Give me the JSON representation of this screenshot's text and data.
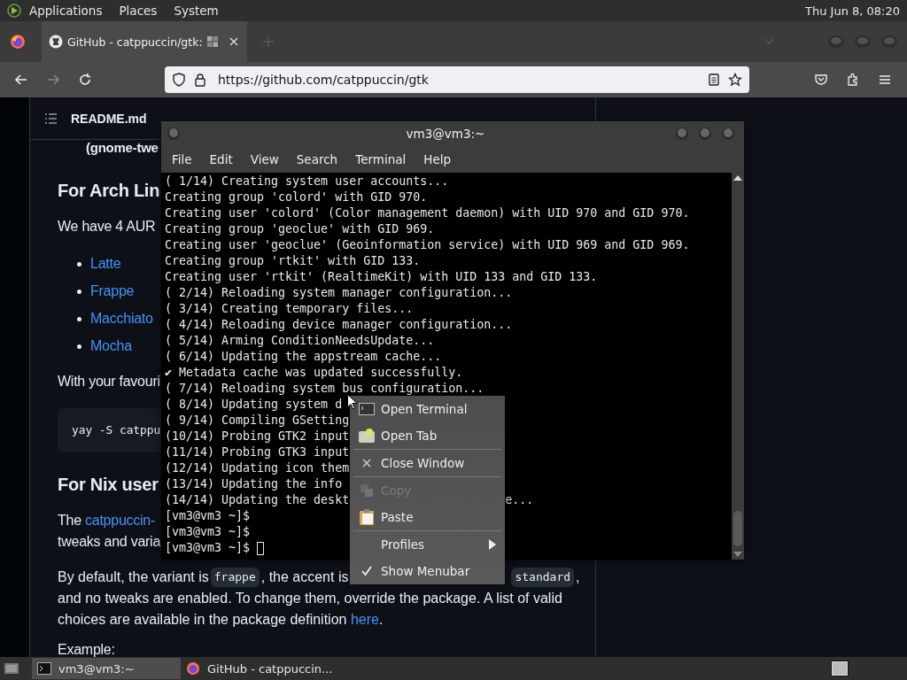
{
  "top_panel": {
    "menus": [
      "Applications",
      "Places",
      "System"
    ],
    "clock": "Thu Jun  8, 08:20"
  },
  "browser": {
    "tabs": [
      {
        "title": "GitHub - catppuccin/gtk:",
        "selected": true
      }
    ],
    "nav_buttons": [
      {
        "kind": "back",
        "disabled": false
      },
      {
        "kind": "forward",
        "disabled": true
      },
      {
        "kind": "reload",
        "disabled": false
      }
    ],
    "url": "https://github.com/catppuccin/gtk",
    "page": {
      "file_header": "README.md",
      "blocks": [
        {
          "kind": "indent",
          "text": "(gnome-twe"
        },
        {
          "kind": "heading",
          "text": "For Arch Lin"
        },
        {
          "kind": "para",
          "text": "We have 4 AUR"
        },
        {
          "kind": "link_item",
          "text": "Latte"
        },
        {
          "kind": "link_item",
          "text": "Frappe"
        },
        {
          "kind": "link_item",
          "text": "Macchiato"
        },
        {
          "kind": "link_item",
          "text": "Mocha"
        },
        {
          "kind": "para",
          "text": "With your favouri"
        },
        {
          "kind": "code",
          "text": "yay -S catppu"
        },
        {
          "kind": "heading",
          "text": "For Nix user"
        },
        {
          "kind": "para_link",
          "before": "The ",
          "link": "catppuccin-",
          "line2": "tweaks and varia"
        },
        {
          "kind": "defaults",
          "before": "By default, the variant is",
          "code1": "frappe",
          "mid": ", the accent is",
          "code2": "standard",
          "after": ",",
          "rest": "and no tweaks are enabled. To change them, override the package. A list of valid choices are available in the package definition ",
          "link": "here",
          "end": "."
        },
        {
          "kind": "para",
          "text": "Example:"
        }
      ]
    }
  },
  "terminal": {
    "title": "vm3@vm3:~",
    "menus": [
      "File",
      "Edit",
      "View",
      "Search",
      "Terminal",
      "Help"
    ],
    "lines": [
      {
        "text": "( 1/14) Creating system user accounts..."
      },
      {
        "text": "Creating group 'colord' with GID 970."
      },
      {
        "text": "Creating user 'colord' (Color management daemon) with UID 970 and GID 970."
      },
      {
        "text": "Creating group 'geoclue' with GID 969."
      },
      {
        "text": "Creating user 'geoclue' (Geoinformation service) with UID 969 and GID 969."
      },
      {
        "text": "Creating group 'rtkit' with GID 133."
      },
      {
        "text": "Creating user 'rtkit' (RealtimeKit) with UID 133 and GID 133."
      },
      {
        "text": "( 2/14) Reloading system manager configuration..."
      },
      {
        "text": "( 3/14) Creating temporary files..."
      },
      {
        "text": "( 4/14) Reloading device manager configuration..."
      },
      {
        "text": "( 5/14) Arming ConditionNeedsUpdate..."
      },
      {
        "text": "( 6/14) Updating the appstream cache..."
      },
      {
        "text": "✔ Metadata cache was updated successfully."
      },
      {
        "text": "( 7/14) Reloading system bus configuration..."
      },
      {
        "text": "( 8/14) Updating system d"
      },
      {
        "text": "( 9/14) Compiling GSetting"
      },
      {
        "text": "(10/14) Probing GTK2 input"
      },
      {
        "text": "(11/14) Probing GTK3 input"
      },
      {
        "text": "(12/14) Updating icon them"
      },
      {
        "text": "(13/14) Updating the info"
      },
      {
        "text": "(14/14) Updating the deskt",
        "tail": "e..."
      },
      {
        "text": "[vm3@vm3 ~]$"
      },
      {
        "text": "[vm3@vm3 ~]$"
      },
      {
        "text": "[vm3@vm3 ~]$"
      }
    ]
  },
  "context_menu": [
    {
      "kind": "terminal",
      "label": "Open Terminal",
      "disabled": false
    },
    {
      "kind": "tab",
      "label": "Open Tab",
      "disabled": false
    },
    {
      "kind": "separator"
    },
    {
      "kind": "close",
      "label": "Close Window",
      "disabled": false
    },
    {
      "kind": "separator"
    },
    {
      "kind": "copy",
      "label": "Copy",
      "disabled": true
    },
    {
      "kind": "paste",
      "label": "Paste",
      "disabled": false
    },
    {
      "kind": "separator"
    },
    {
      "kind": "submenu",
      "label": "Profiles",
      "disabled": false
    },
    {
      "kind": "check",
      "label": "Show Menubar",
      "checked": true
    }
  ],
  "taskbar": {
    "tasks": [
      {
        "kind": "terminal",
        "title": "vm3@vm3:~",
        "selected": true
      },
      {
        "kind": "browser",
        "title": "GitHub - catppuccin...",
        "selected": false
      }
    ]
  }
}
